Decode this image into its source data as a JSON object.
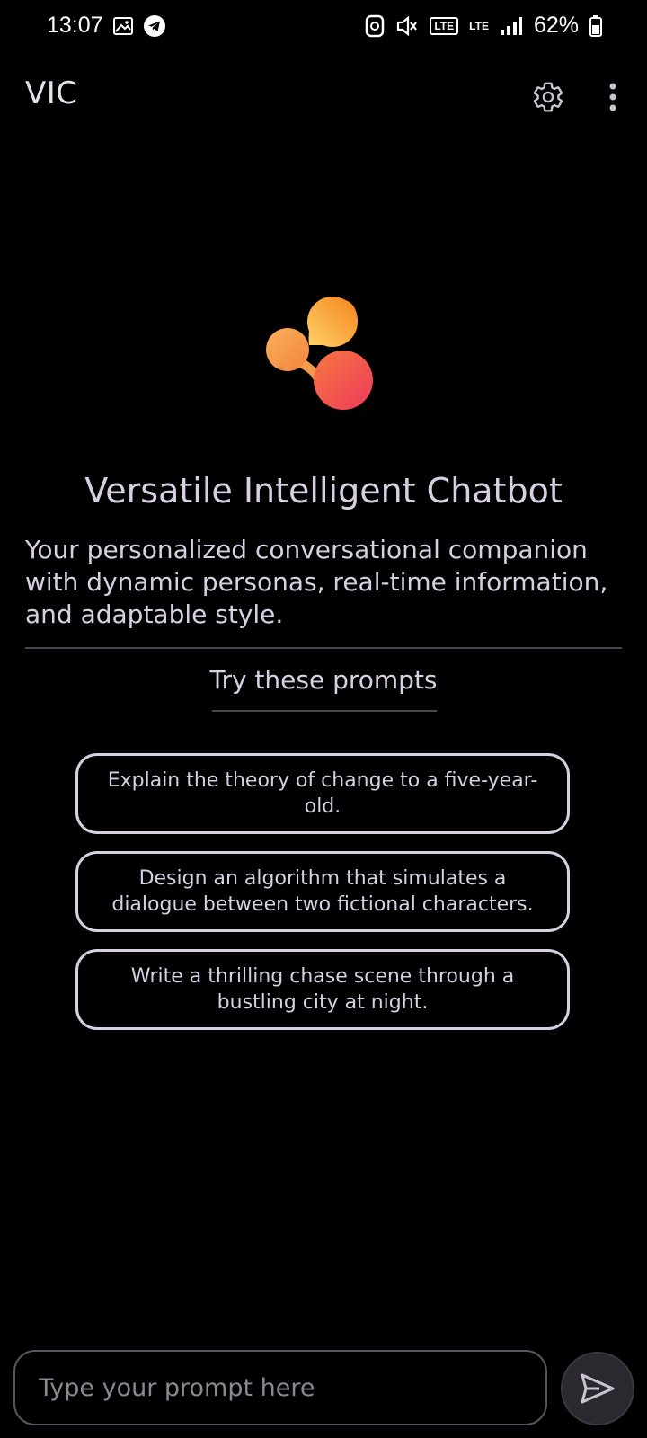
{
  "status_bar": {
    "time": "13:07",
    "battery": "62%",
    "left_icons": [
      "gallery-icon",
      "telegram-icon"
    ],
    "right_icons": [
      "screenshot-icon",
      "mute-icon",
      "volte-icon",
      "lte-icon",
      "signal-icon",
      "battery-icon"
    ],
    "volte_label": "LTE",
    "lte_label": "LTE"
  },
  "app_bar": {
    "title": "VIC",
    "icons": [
      "gear-icon",
      "more-vert-icon"
    ]
  },
  "hero": {
    "logo_icon": "vic-logo-icon",
    "headline": "Versatile Intelligent Chatbot",
    "description": "Your personalized conversational companion with dynamic personas, real-time information, and adaptable style."
  },
  "prompts": {
    "heading": "Try these prompts",
    "items": [
      "Explain the theory of change to a five-year-old.",
      "Design an algorithm that simulates a dialogue between two fictional characters.",
      "Write a thrilling chase scene through a bustling city at night."
    ]
  },
  "composer": {
    "placeholder": "Type your prompt here",
    "value": "",
    "send_icon": "send-icon"
  },
  "colors": {
    "background": "#000000",
    "text": "#d8cfe2",
    "logo_orange": "#f5913e",
    "logo_pink": "#f0455b",
    "logo_yellow": "#ffd267"
  }
}
